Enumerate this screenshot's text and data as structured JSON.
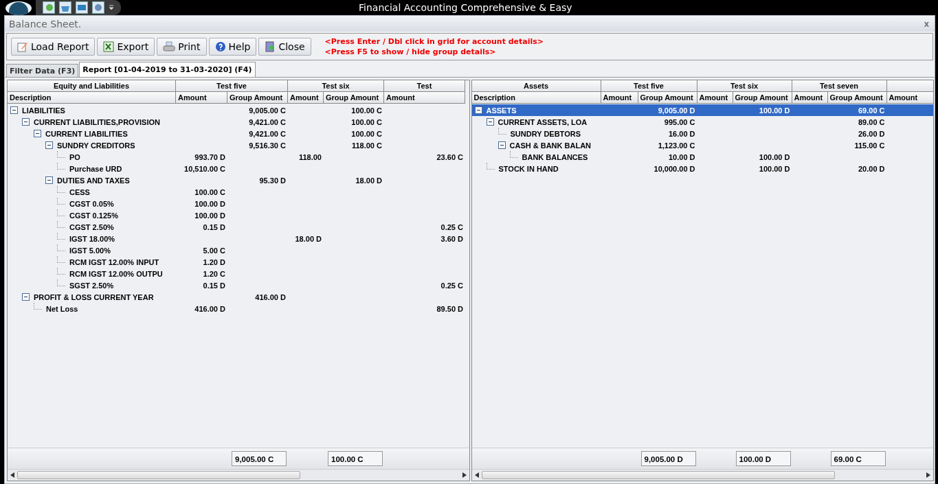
{
  "app_title": "Financial Accounting Comprehensive & Easy",
  "window": {
    "title": "Balance Sheet.",
    "close": "x"
  },
  "toolbar": [
    {
      "label": "Load Report",
      "kind": "edit"
    },
    {
      "label": "Export",
      "kind": "excel"
    },
    {
      "label": "Print",
      "kind": "print"
    },
    {
      "label": "Help",
      "kind": "help"
    },
    {
      "label": "Close",
      "kind": "exit"
    }
  ],
  "hints": [
    "<Press Enter / Dbl click in grid for account details>",
    "<Press F5 to show / hide group details>"
  ],
  "tabs": [
    {
      "label": "Filter Data (F3)",
      "selected": false
    },
    {
      "label": "Report [01-04-2019 to 31-03-2020] (F4)",
      "selected": true
    }
  ],
  "grids": [
    {
      "bands": [
        {
          "label": "Equity and Liabilities",
          "columns": [
            "Description"
          ]
        },
        {
          "label": "Test five",
          "columns": [
            "Amount",
            "Group Amount"
          ]
        },
        {
          "label": "Test six",
          "columns": [
            "Amount",
            "Group Amount"
          ]
        },
        {
          "label": "Test",
          "columns": [
            "Amount"
          ]
        }
      ],
      "rows": [
        {
          "name": "LIABILITIES",
          "values": {
            "group_amount_1": "9,005.00 C",
            "group_amount_2": "100.00 C"
          },
          "selected": false,
          "expanded": true,
          "children": [
            {
              "name": "CURRENT LIABILITIES,PROVISION",
              "values": {
                "group_amount_1": "9,421.00 C",
                "group_amount_2": "100.00 C"
              },
              "selected": false,
              "expanded": true,
              "children": [
                {
                  "name": "CURRENT LIABILITIES",
                  "values": {
                    "group_amount_1": "9,421.00 C",
                    "group_amount_2": "100.00 C"
                  },
                  "selected": false,
                  "expanded": true,
                  "children": [
                    {
                      "name": "SUNDRY CREDITORS",
                      "values": {
                        "group_amount_1": "9,516.30 C",
                        "group_amount_2": "118.00 C"
                      },
                      "selected": false,
                      "expanded": true,
                      "children": [
                        {
                          "name": "PO",
                          "values": {
                            "amount_1": "993.70 D",
                            "amount_2": "118.00",
                            "amount_3": "23.60 C"
                          },
                          "selected": false
                        },
                        {
                          "name": "Purchase URD",
                          "values": {
                            "amount_1": "10,510.00 C"
                          },
                          "selected": false
                        }
                      ]
                    },
                    {
                      "name": "DUTIES AND TAXES",
                      "values": {
                        "group_amount_1": "95.30 D",
                        "group_amount_2": "18.00 D"
                      },
                      "selected": false,
                      "expanded": true,
                      "children": [
                        {
                          "name": "CESS",
                          "values": {
                            "amount_1": "100.00 C"
                          },
                          "selected": false
                        },
                        {
                          "name": "CGST 0.05%",
                          "values": {
                            "amount_1": "100.00 D"
                          },
                          "selected": false
                        },
                        {
                          "name": "CGST 0.125%",
                          "values": {
                            "amount_1": "100.00 D"
                          },
                          "selected": false
                        },
                        {
                          "name": "CGST 2.50%",
                          "values": {
                            "amount_1": "0.15 D",
                            "amount_3": "0.25 C"
                          },
                          "selected": false
                        },
                        {
                          "name": "IGST 18.00%",
                          "values": {
                            "amount_2": "18.00 D",
                            "amount_3": "3.60 D"
                          },
                          "selected": false
                        },
                        {
                          "name": "IGST 5.00%",
                          "values": {
                            "amount_1": "5.00 C"
                          },
                          "selected": false
                        },
                        {
                          "name": "RCM IGST 12.00% INPUT",
                          "values": {
                            "amount_1": "1.20 D"
                          },
                          "selected": false
                        },
                        {
                          "name": "RCM IGST 12.00% OUTPU",
                          "values": {
                            "amount_1": "1.20 C"
                          },
                          "selected": false
                        },
                        {
                          "name": "SGST 2.50%",
                          "values": {
                            "amount_1": "0.15 D",
                            "amount_3": "0.25 C"
                          },
                          "selected": false
                        }
                      ]
                    }
                  ]
                }
              ]
            },
            {
              "name": "PROFIT & LOSS CURRENT YEAR",
              "values": {
                "group_amount_1": "416.00 D"
              },
              "selected": false,
              "expanded": true,
              "children": [
                {
                  "name": "Net Loss",
                  "values": {
                    "amount_1": "416.00 D",
                    "amount_3": "89.50 D"
                  },
                  "selected": false
                }
              ]
            }
          ]
        }
      ],
      "totals": {
        "group_amount_1": "9,005.00 C",
        "group_amount_2": "100.00 C"
      }
    },
    {
      "bands": [
        {
          "label": "Assets",
          "columns": [
            "Description"
          ]
        },
        {
          "label": "Test five",
          "columns": [
            "Amount",
            "Group Amount"
          ]
        },
        {
          "label": "Test six",
          "columns": [
            "Amount",
            "Group Amount"
          ]
        },
        {
          "label": "Test seven",
          "columns": [
            "Amount",
            "Group Amount"
          ]
        },
        {
          "columns": [
            "Amount"
          ]
        }
      ],
      "rows": [
        {
          "name": "ASSETS",
          "values": {
            "group_amount_1": "9,005.00 D",
            "group_amount_2": "100.00 D",
            "group_amount_3": "69.00 C"
          },
          "selected": true,
          "expanded": true,
          "children": [
            {
              "name": "CURRENT ASSETS, LOA",
              "values": {
                "group_amount_1": "995.00 C",
                "group_amount_3": "89.00 C"
              },
              "selected": false,
              "expanded": true,
              "children": [
                {
                  "name": "SUNDRY DEBTORS",
                  "values": {
                    "group_amount_1": "16.00 D",
                    "group_amount_3": "26.00 D"
                  },
                  "selected": false
                },
                {
                  "name": "CASH & BANK BALAN",
                  "values": {
                    "group_amount_1": "1,123.00 C",
                    "group_amount_3": "115.00 C"
                  },
                  "selected": false,
                  "expanded": true,
                  "children": [
                    {
                      "name": "BANK BALANCES",
                      "values": {
                        "group_amount_1": "10.00 D",
                        "group_amount_2": "100.00 D"
                      },
                      "selected": false
                    }
                  ]
                }
              ]
            },
            {
              "name": "STOCK IN HAND",
              "values": {
                "group_amount_1": "10,000.00 D",
                "group_amount_2": "100.00 D",
                "group_amount_3": "20.00 D"
              },
              "selected": false
            }
          ]
        }
      ],
      "totals": {
        "group_amount_1": "9,005.00 D",
        "group_amount_2": "100.00 D",
        "group_amount_3": "69.00 C"
      }
    }
  ]
}
